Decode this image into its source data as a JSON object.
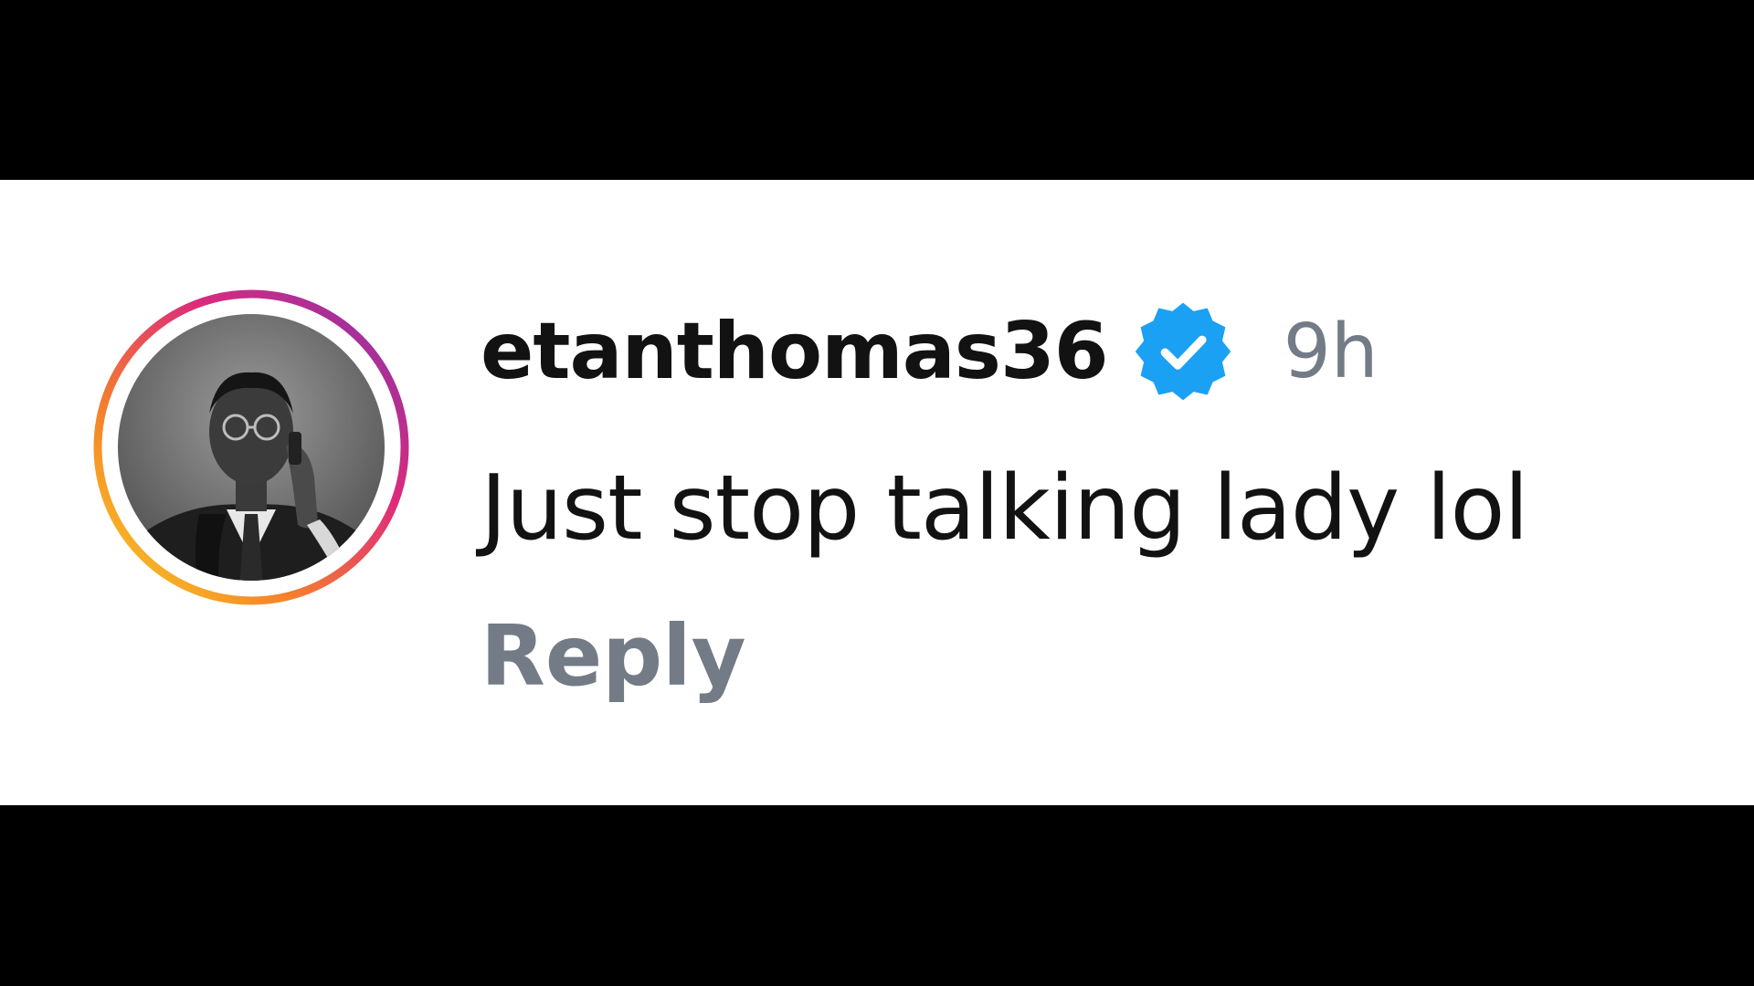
{
  "comment": {
    "username": "etanthomas36",
    "verified": true,
    "timestamp": "9h",
    "text": "Just stop talking lady lol",
    "reply_label": "Reply"
  },
  "icons": {
    "verified_badge": "verified-check-icon",
    "avatar_ring": "story-ring-gradient"
  },
  "colors": {
    "background": "#ffffff",
    "letterbox": "#000000",
    "username": "#121212",
    "secondary_text": "#737b86",
    "verified_blue": "#1aa1f4",
    "story_ring": [
      "#f58529",
      "#dd2a7b",
      "#8134af"
    ]
  }
}
